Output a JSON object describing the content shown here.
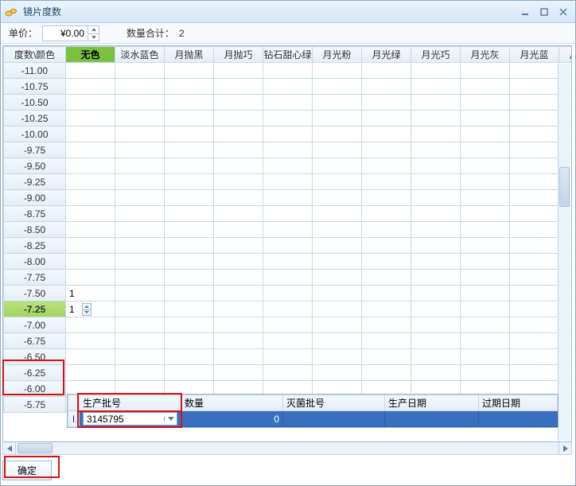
{
  "window": {
    "title": "镜片度数"
  },
  "toolbar": {
    "price_label": "单价：",
    "price_value": "¥0.00",
    "qty_label": "数量合计：",
    "qty_value": "2"
  },
  "grid": {
    "corner": "度数\\颜色",
    "columns": [
      "无色",
      "淡水蓝色",
      "月抛黑",
      "月抛巧",
      "钻石甜心绿",
      "月光粉",
      "月光绿",
      "月光巧",
      "月光灰",
      "月光蓝",
      "月光黑"
    ],
    "rows": [
      "-11.00",
      "-10.75",
      "-10.50",
      "-10.25",
      "-10.00",
      "-9.75",
      "-9.50",
      "-9.25",
      "-9.00",
      "-8.75",
      "-8.50",
      "-8.25",
      "-8.00",
      "-7.75",
      "-7.50",
      "-7.25",
      "-7.00",
      "-6.75",
      "-6.50",
      "-6.25",
      "-6.00",
      "-5.75"
    ],
    "selected_col_index": 0,
    "selected_row_index": 15,
    "cells": {
      "14_0": "1",
      "15_0_spin": "1"
    }
  },
  "subgrid": {
    "headers": [
      "生产批号",
      "数量",
      "灭菌批号",
      "生产日期",
      "过期日期"
    ],
    "row": {
      "batch_combo": "3145795",
      "qty": "0",
      "ster": "",
      "prod_date": "",
      "exp_date": ""
    }
  },
  "buttons": {
    "ok": "确定"
  },
  "chart_data": {
    "type": "table",
    "title": "镜片度数",
    "row_labels": [
      "-11.00",
      "-10.75",
      "-10.50",
      "-10.25",
      "-10.00",
      "-9.75",
      "-9.50",
      "-9.25",
      "-9.00",
      "-8.75",
      "-8.50",
      "-8.25",
      "-8.00",
      "-7.75",
      "-7.50",
      "-7.25",
      "-7.00",
      "-6.75",
      "-6.50",
      "-6.25",
      "-6.00",
      "-5.75"
    ],
    "col_labels": [
      "无色",
      "淡水蓝色",
      "月抛黑",
      "月抛巧",
      "钻石甜心绿",
      "月光粉",
      "月光绿",
      "月光巧",
      "月光灰",
      "月光蓝",
      "月光黑"
    ],
    "nonzero_cells": [
      {
        "row": "-7.50",
        "col": "无色",
        "value": 1
      },
      {
        "row": "-7.25",
        "col": "无色",
        "value": 1
      }
    ],
    "total_qty": 2,
    "unit_price": 0.0
  }
}
